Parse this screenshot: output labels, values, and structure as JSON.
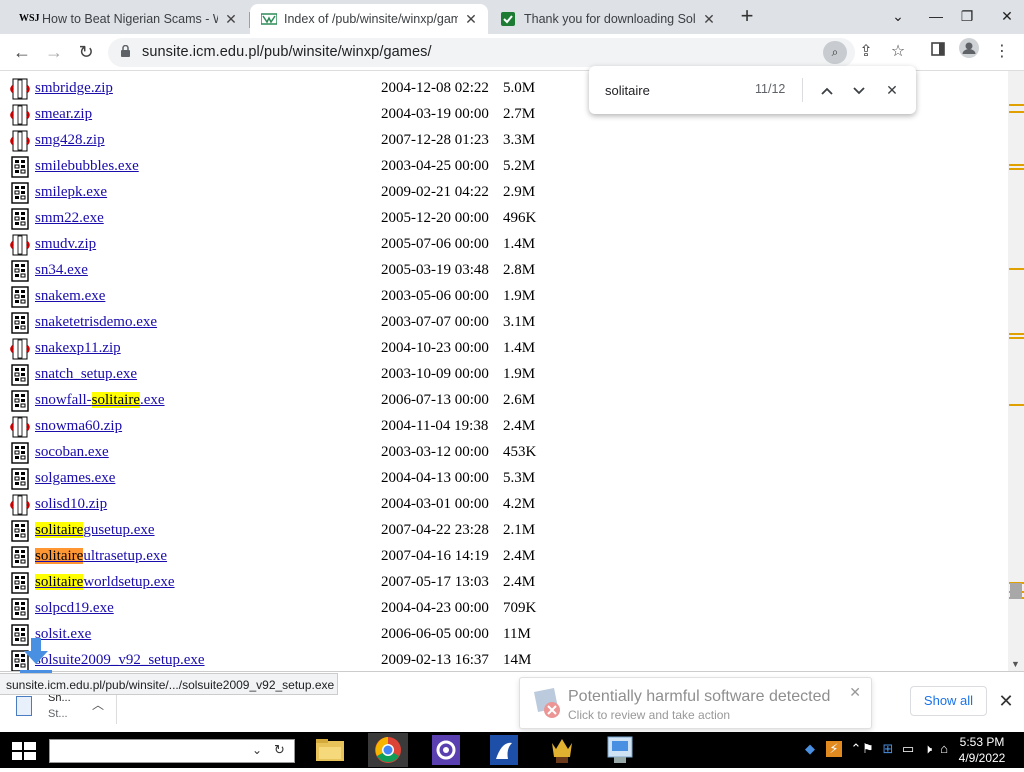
{
  "tabs": [
    {
      "title": "How to Beat Nigerian Scams - W",
      "favicon": "wsj-favicon",
      "active": false
    },
    {
      "title": "Index of /pub/winsite/winxp/gam",
      "favicon": "winsite-favicon",
      "active": true
    },
    {
      "title": "Thank you for downloading Solit",
      "favicon": "download-favicon",
      "active": false
    }
  ],
  "tab_close_symbol": "✕",
  "new_tab_symbol": "+",
  "address": {
    "url": "sunsite.icm.edu.pl/pub/winsite/winxp/games/"
  },
  "find": {
    "query": "solitaire",
    "count": "11/12"
  },
  "files": [
    {
      "name": "smbridge.zip",
      "date": "2004-12-08 02:22",
      "size": "5.0M",
      "type": "zip"
    },
    {
      "name": "smear.zip",
      "date": "2004-03-19 00:00",
      "size": "2.7M",
      "type": "zip"
    },
    {
      "name": "smg428.zip",
      "date": "2007-12-28 01:23",
      "size": "3.3M",
      "type": "zip"
    },
    {
      "name": "smilebubbles.exe",
      "date": "2003-04-25 00:00",
      "size": "5.2M",
      "type": "exe"
    },
    {
      "name": "smilepk.exe",
      "date": "2009-02-21 04:22",
      "size": "2.9M",
      "type": "exe"
    },
    {
      "name": "smm22.exe",
      "date": "2005-12-20 00:00",
      "size": "496K",
      "type": "exe"
    },
    {
      "name": "smudv.zip",
      "date": "2005-07-06 00:00",
      "size": "1.4M",
      "type": "zip"
    },
    {
      "name": "sn34.exe",
      "date": "2005-03-19 03:48",
      "size": "2.8M",
      "type": "exe"
    },
    {
      "name": "snakem.exe",
      "date": "2003-05-06 00:00",
      "size": "1.9M",
      "type": "exe"
    },
    {
      "name": "snaketetrisdemo.exe",
      "date": "2003-07-07 00:00",
      "size": "3.1M",
      "type": "exe"
    },
    {
      "name": "snakexp11.zip",
      "date": "2004-10-23 00:00",
      "size": "1.4M",
      "type": "zip"
    },
    {
      "name": "snatch_setup.exe",
      "date": "2003-10-09 00:00",
      "size": "1.9M",
      "type": "exe"
    },
    {
      "name": "snowfall-solitaire.exe",
      "pre": "snowfall-",
      "match": "solitaire",
      "post": ".exe",
      "highlight": "match",
      "date": "2006-07-13 00:00",
      "size": "2.6M",
      "type": "exe"
    },
    {
      "name": "snowma60.zip",
      "date": "2004-11-04 19:38",
      "size": "2.4M",
      "type": "zip"
    },
    {
      "name": "socoban.exe",
      "date": "2003-03-12 00:00",
      "size": "453K",
      "type": "exe"
    },
    {
      "name": "solgames.exe",
      "date": "2004-04-13 00:00",
      "size": "5.3M",
      "type": "exe"
    },
    {
      "name": "solisd10.zip",
      "date": "2004-03-01 00:00",
      "size": "4.2M",
      "type": "zip"
    },
    {
      "name": "solitairegusetup.exe",
      "pre": "",
      "match": "solitaire",
      "post": "gusetup.exe",
      "highlight": "match",
      "date": "2007-04-22 23:28",
      "size": "2.1M",
      "type": "exe"
    },
    {
      "name": "solitaireultrasetup.exe",
      "pre": "",
      "match": "solitaire",
      "post": "ultrasetup.exe",
      "highlight": "active",
      "date": "2007-04-16 14:19",
      "size": "2.4M",
      "type": "exe"
    },
    {
      "name": "solitaireworldsetup.exe",
      "pre": "",
      "match": "solitaire",
      "post": "worldsetup.exe",
      "highlight": "match",
      "date": "2007-05-17 13:03",
      "size": "2.4M",
      "type": "exe"
    },
    {
      "name": "solpcd19.exe",
      "date": "2004-04-23 00:00",
      "size": "709K",
      "type": "exe"
    },
    {
      "name": "solsit.exe",
      "display": "solsit.exe",
      "date": "2006-06-05 00:00",
      "size": "11M",
      "type": "exe"
    },
    {
      "name": "solsuite2009_v92_setup.exe",
      "display": "solsuite2009_v92_setup.exe",
      "date": "2009-02-13 16:37",
      "size": "14M",
      "type": "exe"
    }
  ],
  "status_url": "sunsite.icm.edu.pl/pub/winsite/.../solsuite2009_v92_setup.exe",
  "download": {
    "name": "Sh...",
    "status": "St..."
  },
  "toast": {
    "title": "Potentially harmful software detected",
    "subtitle": "Click to review and take action"
  },
  "show_all_label": "Show all",
  "clock": {
    "time": "5:53 PM",
    "date": "4/9/2022"
  },
  "colors": {
    "find_match": "#ffff00",
    "find_active": "#ff9632",
    "link": "#1a0dab",
    "accent": "#1a73e8"
  }
}
